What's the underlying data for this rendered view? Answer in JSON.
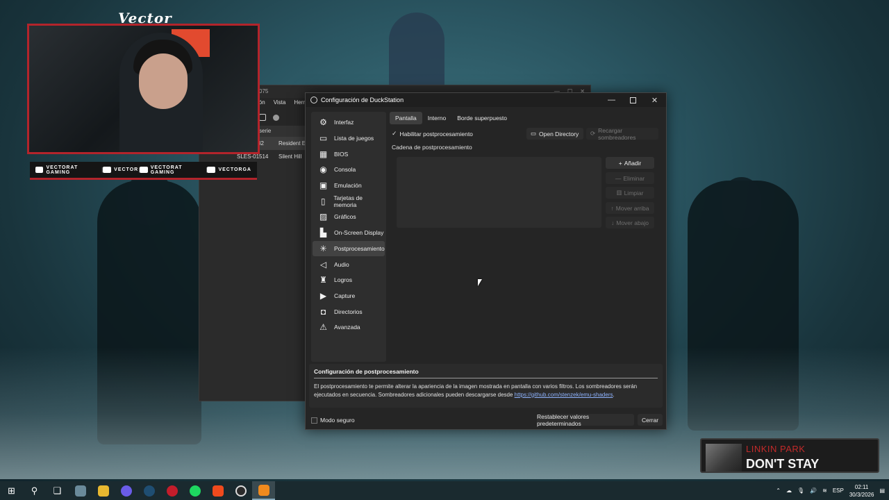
{
  "overlay": {
    "streamer_name": "Vector",
    "socials": [
      {
        "icon": "youtube-icon",
        "label": "VECTORAT GAMING"
      },
      {
        "icon": "twitch-icon",
        "label": "VECTOR"
      },
      {
        "icon": "twitter-icon",
        "label": "VECTORAT GAMING"
      },
      {
        "icon": "instagram-icon",
        "label": "VECTORGA"
      }
    ],
    "separator": "|"
  },
  "background_window": {
    "title_fragment": "075",
    "menu": [
      "ción",
      "Vista",
      "Herr"
    ],
    "column_header": "serie",
    "rows": [
      {
        "code": "32",
        "title": "Resident Ev"
      },
      {
        "code": "SLES-01514",
        "title": "Silent Hill"
      }
    ]
  },
  "dialog": {
    "title": "Configuración de DuckStation",
    "controls": {
      "minimize": "—",
      "close": "✕"
    },
    "sidebar": [
      {
        "label": "Interfaz",
        "icon": "gear-icon",
        "glyph": "⚙"
      },
      {
        "label": "Lista de juegos",
        "icon": "folder-list-icon",
        "glyph": "▭"
      },
      {
        "label": "BIOS",
        "icon": "chip-icon",
        "glyph": "▦"
      },
      {
        "label": "Consola",
        "icon": "console-icon",
        "glyph": "◉"
      },
      {
        "label": "Emulación",
        "icon": "cpu-icon",
        "glyph": "▣"
      },
      {
        "label": "Tarjetas de memoria",
        "icon": "memory-card-icon",
        "glyph": "▯"
      },
      {
        "label": "Gráficos",
        "icon": "image-icon",
        "glyph": "▨"
      },
      {
        "label": "On-Screen Display",
        "icon": "bar-chart-icon",
        "glyph": "▙"
      },
      {
        "label": "Postprocesamiento",
        "icon": "sparkle-icon",
        "glyph": "✳",
        "active": true
      },
      {
        "label": "Audio",
        "icon": "speaker-icon",
        "glyph": "◁"
      },
      {
        "label": "Logros",
        "icon": "trophy-icon",
        "glyph": "♜"
      },
      {
        "label": "Capture",
        "icon": "video-icon",
        "glyph": "▶"
      },
      {
        "label": "Directorios",
        "icon": "folder-icon",
        "glyph": "◘"
      },
      {
        "label": "Avanzada",
        "icon": "warning-icon",
        "glyph": "⚠"
      }
    ],
    "tabs": [
      "Pantalla",
      "Interno",
      "Borde superpuesto"
    ],
    "active_tab": "Pantalla",
    "enable_label": "Habilitar postprocesamiento",
    "enable_checked": true,
    "open_directory": "Open Directory",
    "reload_shaders": "Recargar sombreadores",
    "chain_label": "Cadena de postprocesamiento",
    "buttons": {
      "add": "Añadir",
      "remove": "Eliminar",
      "clear": "Limpiar",
      "move_up": "Mover arriba",
      "move_down": "Mover abajo"
    },
    "info_title": "Configuración de postprocesamiento",
    "info_text_1": "El postprocesamiento te permite alterar la apariencia de la imagen mostrada en pantalla con varios filtros. Los sombreadores serán ejecutados en secuencia. Sombreadores adicionales pueden descargarse desde ",
    "info_link": "https://github.com/stenzek/emu-shaders",
    "info_text_2": ".",
    "safe_mode": "Modo seguro",
    "reset_defaults": "Restablecer valores predeterminados",
    "close": "Cerrar"
  },
  "now_playing": {
    "artist": "LINKIN PARK",
    "song": "DON'T STAY"
  },
  "taskbar": {
    "language": "ESP",
    "time": "02:11",
    "date": "30/3/2026",
    "apps": [
      "start-icon",
      "search-icon",
      "task-view-icon",
      "monitor-app-icon",
      "file-explorer-icon",
      "discord-icon",
      "steam-icon",
      "opera-icon",
      "spotify-icon",
      "brave-icon",
      "obs-icon",
      "duckstation-icon"
    ]
  }
}
